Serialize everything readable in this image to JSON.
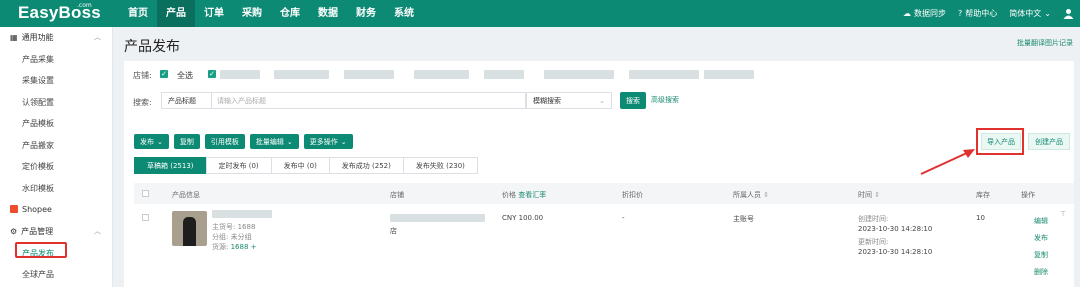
{
  "app": {
    "logo": "EasyBoss",
    "logo_com": ".com"
  },
  "nav": [
    "首页",
    "产品",
    "订单",
    "采购",
    "仓库",
    "数据",
    "财务",
    "系统"
  ],
  "top_right": {
    "sync": "数据同步",
    "help": "帮助中心",
    "lang": "简体中文"
  },
  "sidebar": {
    "group_common": "通用功能",
    "common_items": [
      "产品采集",
      "采集设置",
      "认领配置",
      "产品模板",
      "产品搬家",
      "定价模板",
      "水印模板"
    ],
    "shopee": "Shopee",
    "group_product": "产品管理",
    "product_items": [
      "产品发布",
      "全球产品"
    ]
  },
  "page": {
    "title": "产品发布",
    "batch_link": "批量翻译图片记录"
  },
  "filter": {
    "store_label": "店铺:",
    "select_all": "全选",
    "search_label": "搜索:",
    "search_field": "产品标题",
    "search_placeholder": "请输入产品标题",
    "search_mode": "模糊搜索",
    "search_btn": "搜索",
    "advanced": "高级搜索"
  },
  "toolbar": {
    "publish": "发布",
    "copy": "复制",
    "template": "引用模板",
    "batch_edit": "批量编辑",
    "more": "更多操作",
    "import": "导入产品",
    "create": "创建产品"
  },
  "tabs": [
    "草稿箱 (2513)",
    "定时发布 (0)",
    "发布中 (0)",
    "发布成功 (252)",
    "发布失败 (230)"
  ],
  "table": {
    "headers": {
      "info": "产品信息",
      "store": "店铺",
      "price": "价格",
      "price_link": "查看汇率",
      "discount": "折扣价",
      "owner": "所属人员",
      "time": "时间",
      "stock": "库存",
      "ops": "操作"
    },
    "row": {
      "main_sku_label": "主货号:",
      "main_sku": "1688",
      "category_label": "分组:",
      "category": "未分组",
      "source_label": "货源:",
      "source": "1688",
      "store_suffix": "店",
      "price": "CNY 100.00",
      "discount": "-",
      "owner": "主账号",
      "created_label": "创建时间:",
      "created": "2023-10-30 14:28:10",
      "updated_label": "更新时间:",
      "updated": "2023-10-30 14:28:10",
      "stock": "10",
      "ops": [
        "编辑",
        "发布",
        "复制",
        "删除"
      ]
    }
  }
}
